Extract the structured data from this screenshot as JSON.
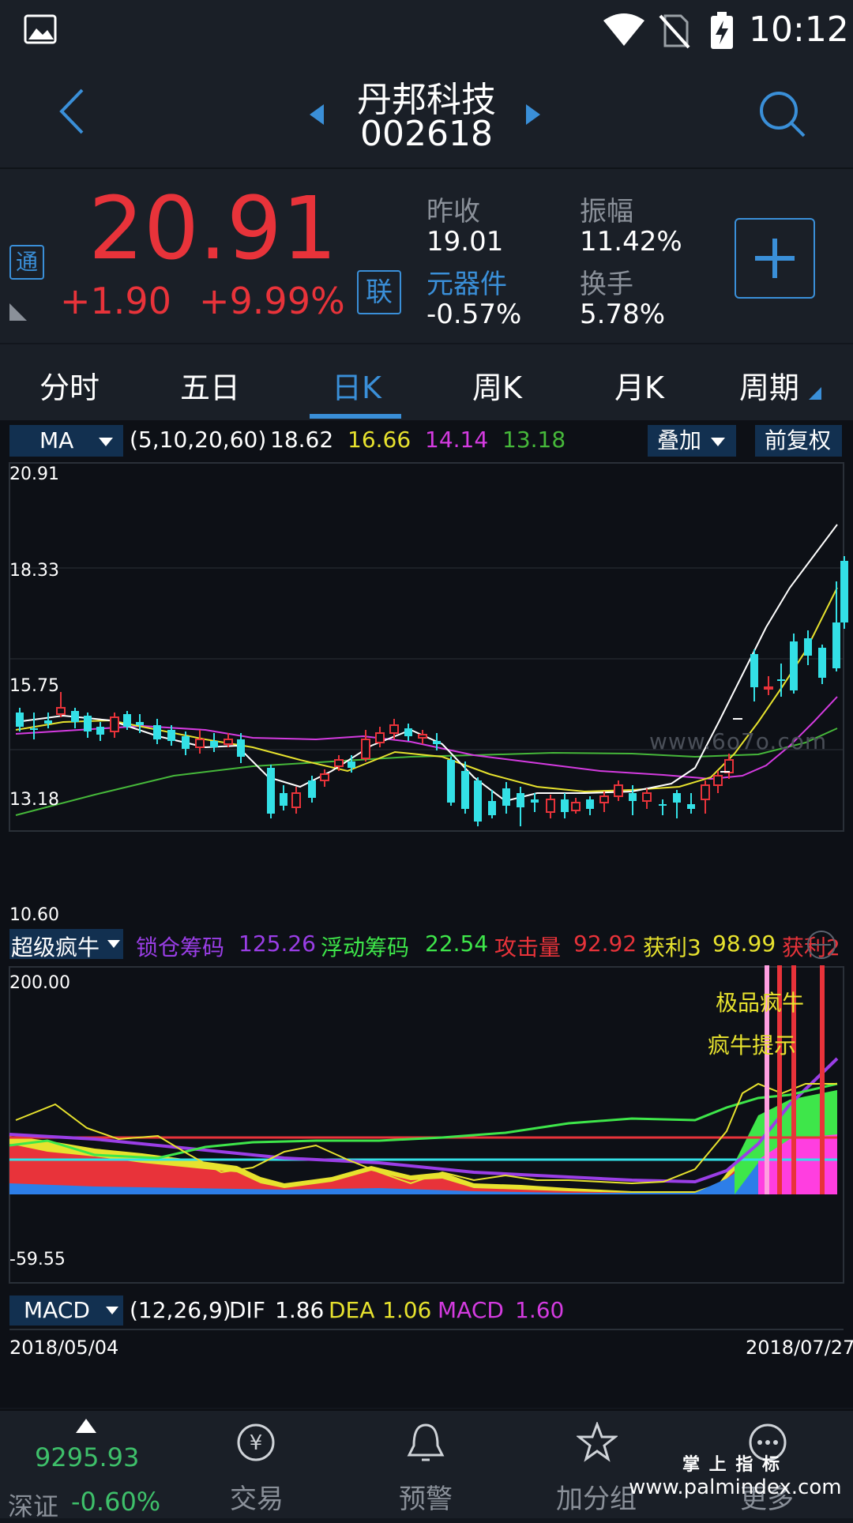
{
  "status_bar": {
    "time": "10:12",
    "icons": [
      "image-icon",
      "wifi-icon",
      "no-sim-icon",
      "battery-charging-icon"
    ]
  },
  "header": {
    "stock_name": "丹邦科技",
    "stock_code": "002618"
  },
  "quote": {
    "price": "20.91",
    "change": "+1.90",
    "change_pct": "+9.99%",
    "badge_tong": "通",
    "badge_lian": "联",
    "prev_close_label": "昨收",
    "prev_close": "19.01",
    "amplitude_label": "振幅",
    "amplitude": "11.42%",
    "sector_label": "元器件",
    "sector_change": "-0.57%",
    "turnover_label": "换手",
    "turnover": "5.78%",
    "add_button": "+"
  },
  "tabs": [
    {
      "label": "分时"
    },
    {
      "label": "五日"
    },
    {
      "label": "日K"
    },
    {
      "label": "周K"
    },
    {
      "label": "月K"
    },
    {
      "label": "周期"
    }
  ],
  "active_tab": "日K",
  "ma_bar": {
    "selector": "MA",
    "params": "(5,10,20,60)",
    "v1": "18.62",
    "v2": "16.66",
    "v3": "14.14",
    "v4": "13.18",
    "overlay": "叠加",
    "adjust": "前复权"
  },
  "kline_axis": {
    "y1": "20.91",
    "y2": "18.33",
    "y3": "15.75",
    "y4": "13.18",
    "y5": "10.60"
  },
  "watermark": "www.6o7o.com",
  "indicator_bar": {
    "selector": "超级疯牛",
    "lock_label": "锁仓筹码",
    "lock_value": "125.26",
    "float_label": "浮动筹码",
    "float_value": "22.54",
    "attack_label": "攻击量",
    "attack_value": "92.92",
    "profit3_label": "获利3",
    "profit3_value": "98.99",
    "profit2_label": "获利2"
  },
  "indicator_axis": {
    "top": "200.00",
    "bottom": "-59.55"
  },
  "indicator_annotations": {
    "a1": "极品疯牛",
    "a2": "疯牛提示"
  },
  "macd_bar": {
    "selector": "MACD",
    "params": "(12,26,9)",
    "dif_label": "DIF",
    "dif": "1.86",
    "dea_label": "DEA",
    "dea": "1.06",
    "macd_label": "MACD",
    "macd": "1.60"
  },
  "date_range": {
    "start": "2018/05/04",
    "end": "2018/07/27"
  },
  "bottom_nav": {
    "index_value": "9295.93",
    "index_name": "深证",
    "index_change": "-0.60%",
    "trade": "交易",
    "alert": "预警",
    "group": "加分组",
    "more": "更多"
  },
  "footer_watermark": {
    "line1": "掌 上 指 标",
    "line2": "www.palmindex.com"
  },
  "colors": {
    "up": "#e8333a",
    "down": "#33e0e6",
    "accent": "#3a8fd8",
    "ma5": "#ffffff",
    "ma10": "#e7e22e",
    "ma20": "#d43be0",
    "ma60": "#46b83a"
  }
}
